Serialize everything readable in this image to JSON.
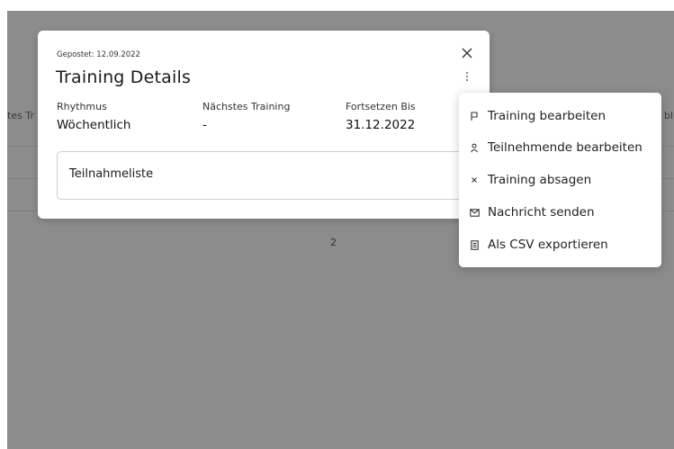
{
  "background": {
    "column_left": "tes Tr",
    "column_right": "bl",
    "pagination": "2"
  },
  "modal": {
    "posted": "Gepostet: 12.09.2022",
    "title": "Training Details",
    "fields": [
      {
        "label": "Rhythmus",
        "value": "Wöchentlich"
      },
      {
        "label": "Nächstes Training",
        "value": "-"
      },
      {
        "label": "Fortsetzen Bis",
        "value": "31.12.2022"
      }
    ],
    "attendance_label": "Teilnahmeliste"
  },
  "menu": {
    "items": [
      {
        "label": "Training bearbeiten",
        "icon": "flag-icon"
      },
      {
        "label": "Teilnehmende bearbeiten",
        "icon": "person-icon"
      },
      {
        "label": "Training absagen",
        "icon": "cross-icon"
      },
      {
        "label": "Nachricht senden",
        "icon": "envelope-icon"
      },
      {
        "label": "Als CSV exportieren",
        "icon": "document-icon"
      }
    ]
  },
  "colors": {
    "overlay": "#8c8c8c",
    "surface": "#ffffff",
    "text": "#1f1f1f"
  }
}
